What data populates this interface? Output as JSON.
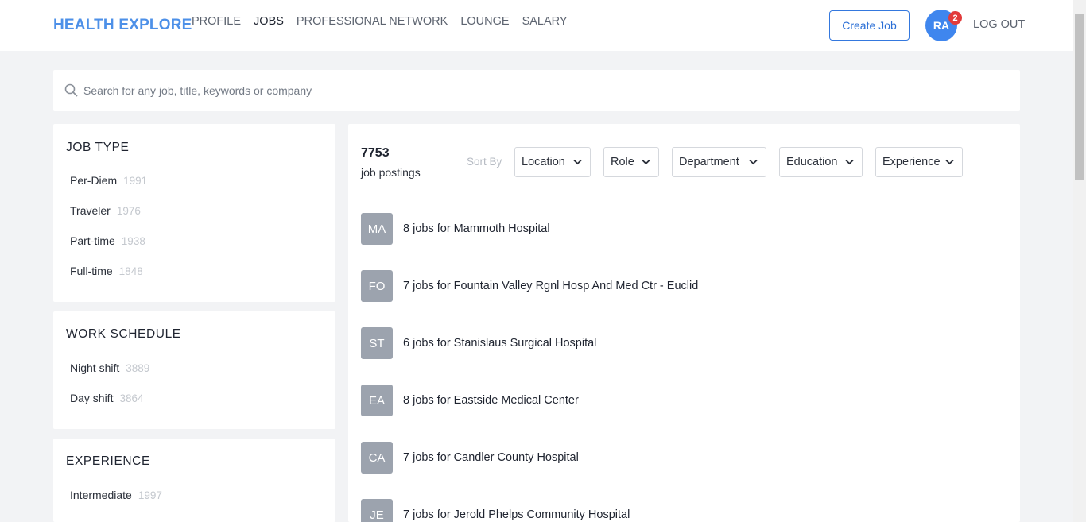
{
  "header": {
    "logo": "HEALTH EXPLORE",
    "nav": [
      "PROFILE",
      "JOBS",
      "PROFESSIONAL NETWORK",
      "LOUNGE",
      "SALARY"
    ],
    "active_nav": "JOBS",
    "create_job": "Create Job",
    "avatar_initials": "RA",
    "notification_count": "2",
    "logout": "LOG OUT"
  },
  "search": {
    "placeholder": "Search for any job, title, keywords or company"
  },
  "filters": {
    "job_type": {
      "title": "JOB TYPE",
      "items": [
        {
          "label": "Per-Diem",
          "count": "1991"
        },
        {
          "label": "Traveler",
          "count": "1976"
        },
        {
          "label": "Part-time",
          "count": "1938"
        },
        {
          "label": "Full-time",
          "count": "1848"
        }
      ]
    },
    "work_schedule": {
      "title": "WORK SCHEDULE",
      "items": [
        {
          "label": "Night shift",
          "count": "3889"
        },
        {
          "label": "Day shift",
          "count": "3864"
        }
      ]
    },
    "experience": {
      "title": "EXPERIENCE",
      "items": [
        {
          "label": "Intermediate",
          "count": "1997"
        }
      ]
    }
  },
  "results": {
    "total": "7753",
    "total_label": "job postings",
    "sort_by": "Sort By",
    "sort_options": [
      "Location",
      "Role",
      "Department",
      "Education",
      "Experience"
    ],
    "jobs": [
      {
        "initials": "MA",
        "text": "8 jobs for Mammoth Hospital"
      },
      {
        "initials": "FO",
        "text": "7 jobs for Fountain Valley Rgnl Hosp And Med Ctr - Euclid"
      },
      {
        "initials": "ST",
        "text": "6 jobs for Stanislaus Surgical Hospital"
      },
      {
        "initials": "EA",
        "text": "8 jobs for Eastside Medical Center"
      },
      {
        "initials": "CA",
        "text": "7 jobs for Candler County Hospital"
      },
      {
        "initials": "JE",
        "text": "7 jobs for Jerold Phelps Community Hospital"
      }
    ]
  },
  "colors": {
    "brand": "#4d90e8",
    "avatar": "#3f86ee",
    "badge": "#e23b3b",
    "company_square": "#9ca3ae",
    "background": "#f2f3f5"
  }
}
